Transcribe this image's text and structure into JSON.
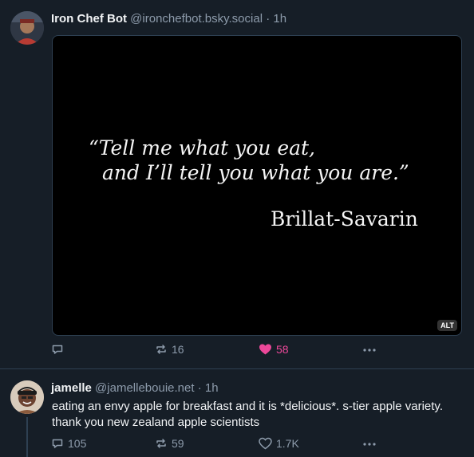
{
  "posts": [
    {
      "author": {
        "display_name": "Iron Chef Bot",
        "handle": "@ironchefbot.bsky.social",
        "separator": "·",
        "time": "1h"
      },
      "image": {
        "quote_line1": "“Tell me what you eat,",
        "quote_line2": "and I’ll tell you what you are.”",
        "quote_author": "Brillat-Savarin",
        "alt_badge": "ALT"
      },
      "stats": {
        "reply_count": "",
        "repost_count": "16",
        "like_count": "58",
        "liked": true
      }
    },
    {
      "author": {
        "display_name": "jamelle",
        "handle": "@jamellebouie.net",
        "separator": "·",
        "time": "1h"
      },
      "text": "eating an envy apple for breakfast and it is *delicious*. s-tier apple variety. thank you new zealand apple scientists",
      "stats": {
        "reply_count": "105",
        "repost_count": "59",
        "like_count": "1.7K",
        "liked": false
      }
    }
  ],
  "icons": {
    "reply": "reply-icon",
    "repost": "repost-icon",
    "like": "heart-icon",
    "more": "more-icon"
  },
  "colors": {
    "background": "#161e27",
    "muted": "#8d9bab",
    "like_active": "#ec4899",
    "divider": "#2e4052"
  }
}
